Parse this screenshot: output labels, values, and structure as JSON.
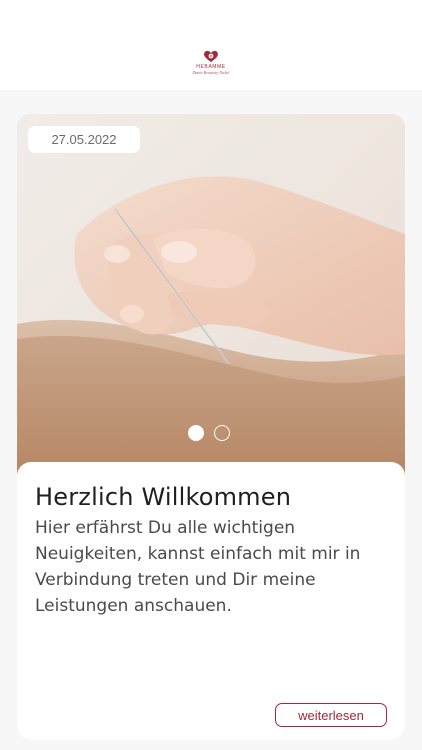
{
  "header": {
    "logo_name": "HEBAMME",
    "logo_sub": "Dania Berzsony Nickel"
  },
  "post": {
    "date": "27.05.2022",
    "title": "Herzlich Willkommen",
    "text": "Hier erfährst Du alle wichtigen Neuigkeiten, kannst einfach mit mir in Verbindung treten und  Dir meine Leistungen anschauen.",
    "more_label": "weiterlesen",
    "carousel": {
      "count": 2,
      "active_index": 0
    }
  },
  "colors": {
    "brand": "#a3293a",
    "background": "#f7f7f7",
    "card": "#ffffff"
  }
}
